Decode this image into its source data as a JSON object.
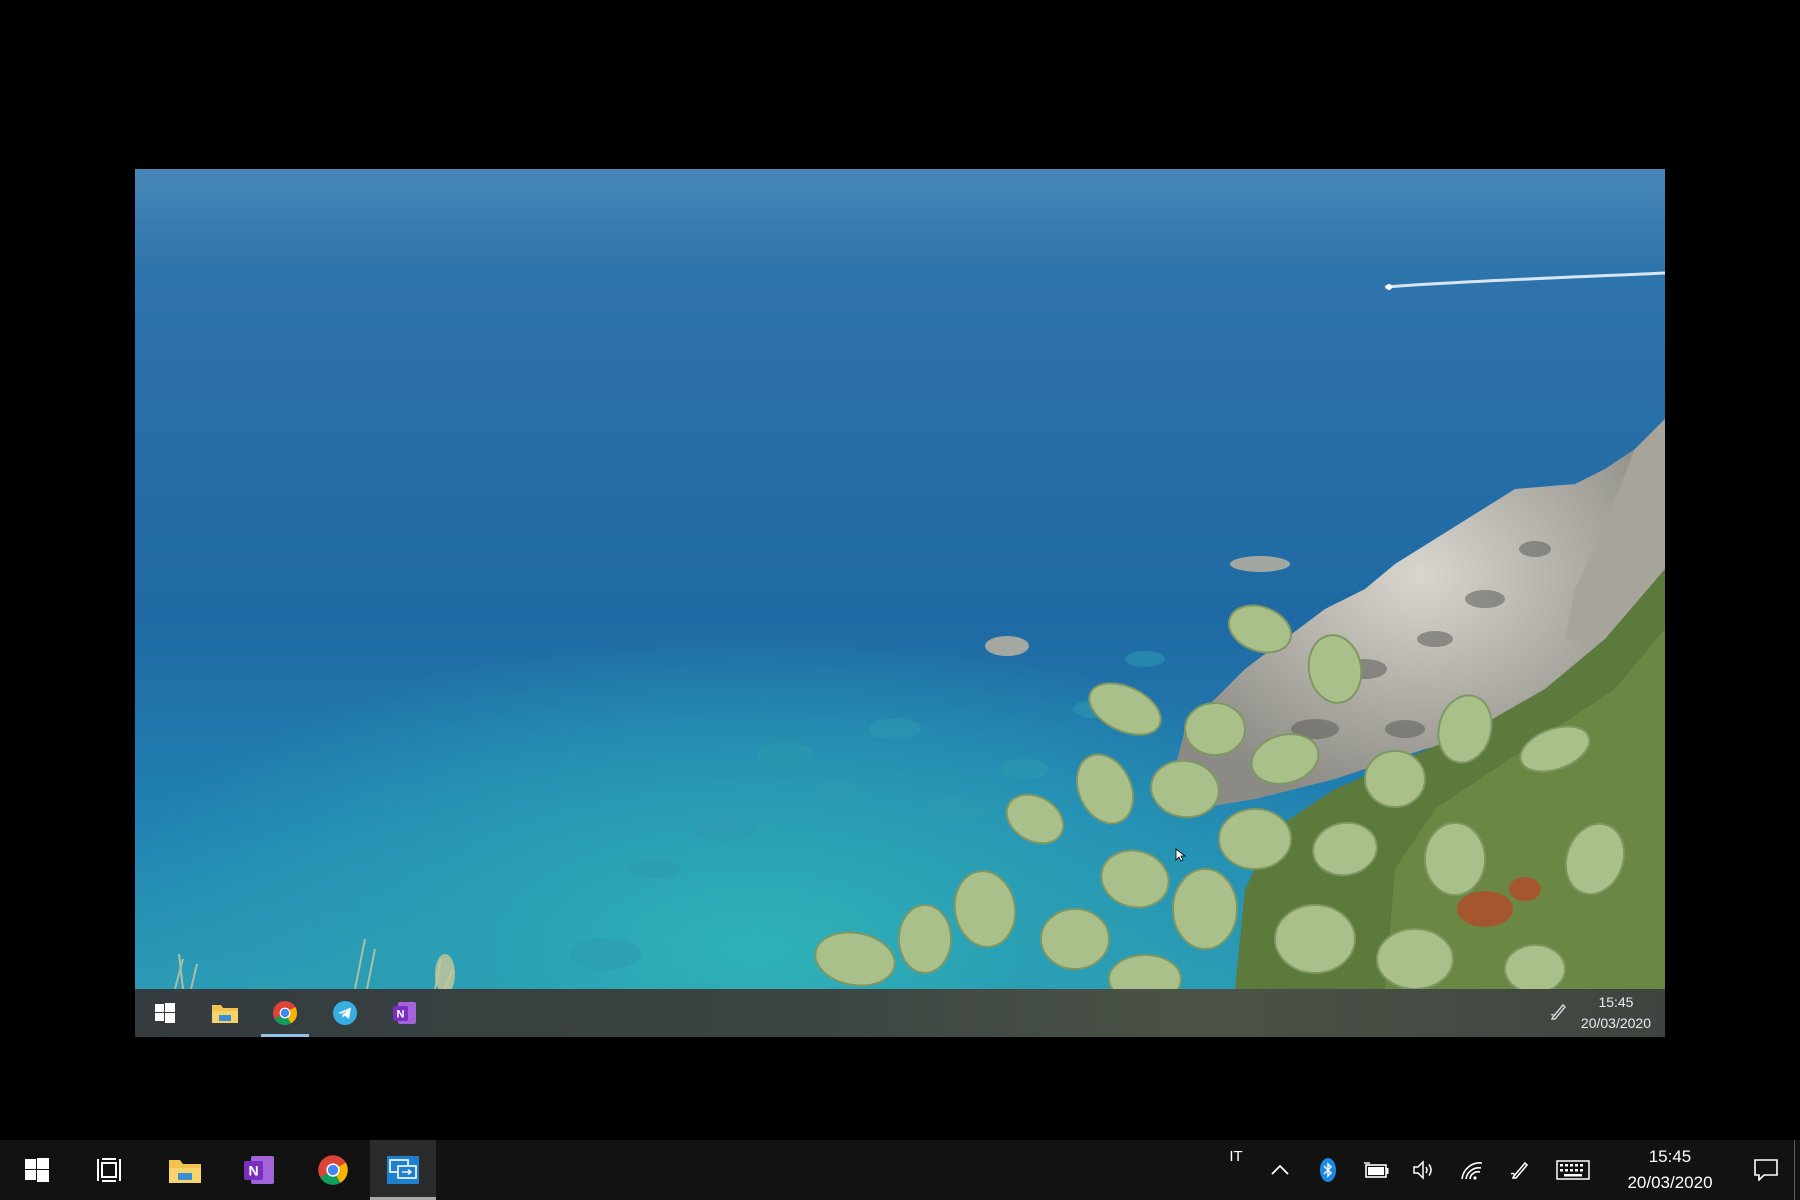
{
  "remote_screen": {
    "taskbar": {
      "apps": [
        {
          "name": "windows-start-icon"
        },
        {
          "name": "file-explorer-icon"
        },
        {
          "name": "chrome-icon",
          "active": true
        },
        {
          "name": "telegram-icon"
        },
        {
          "name": "onenote-icon"
        }
      ],
      "tray_icon": "pen-icon",
      "clock": {
        "time": "15:45",
        "date": "20/03/2020"
      }
    }
  },
  "host_taskbar": {
    "apps": [
      {
        "name": "windows-start-icon"
      },
      {
        "name": "task-view-icon"
      },
      {
        "name": "file-explorer-icon"
      },
      {
        "name": "onenote-icon"
      },
      {
        "name": "chrome-icon"
      },
      {
        "name": "remote-desktop-icon",
        "active": true
      }
    ],
    "tray": {
      "language": "IT",
      "icons": [
        "chevron-up-icon",
        "bluetooth-icon",
        "battery-icon",
        "volume-icon",
        "wifi-icon",
        "pen-icon",
        "keyboard-icon"
      ]
    },
    "clock": {
      "time": "15:45",
      "date": "20/03/2020"
    },
    "notification_icon": "action-center-icon"
  },
  "colors": {
    "sea_deep": "#1f6aa4",
    "sea_shallow": "#2fb3b8",
    "cactus": "#a9c08a",
    "host_taskbar": "#121212",
    "onenote": "#7b2fbf",
    "telegram": "#37aee2",
    "bluetooth": "#1e88e5"
  }
}
